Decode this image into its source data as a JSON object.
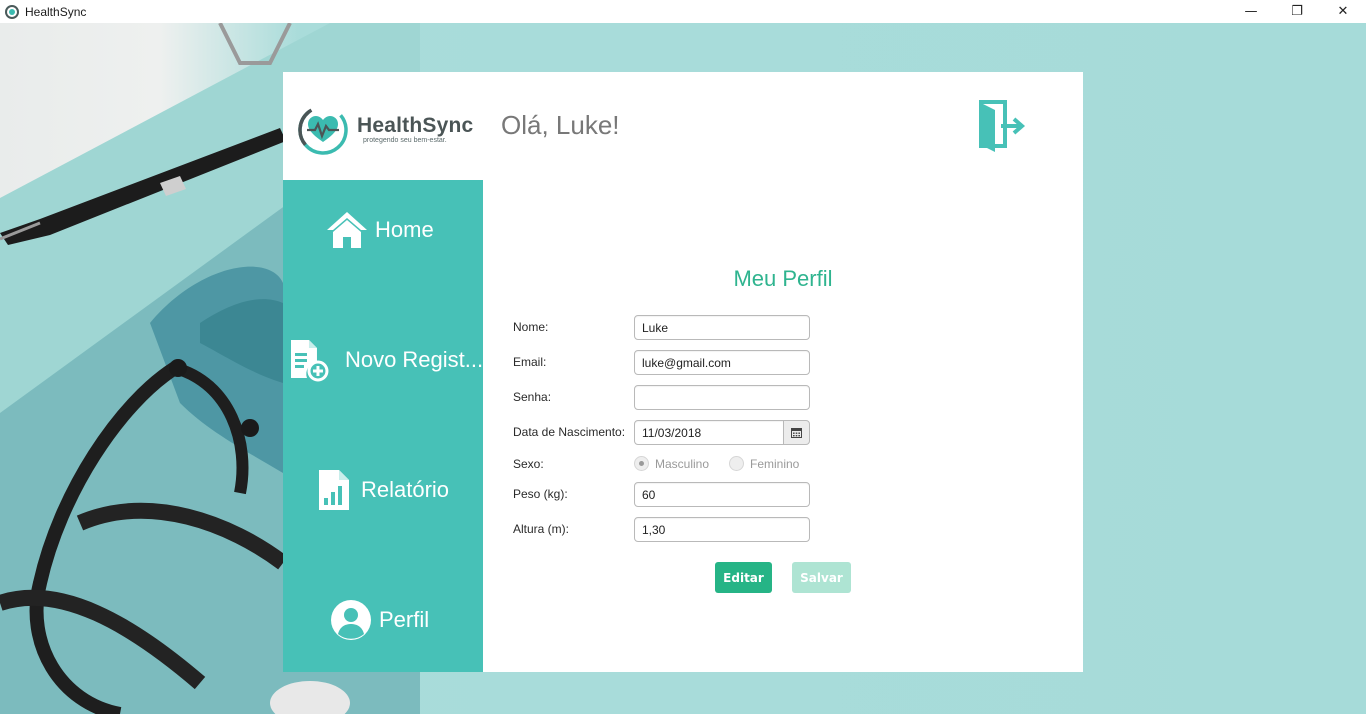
{
  "window": {
    "title": "HealthSync",
    "controls": {
      "minimize": "—",
      "maximize": "❐",
      "close": "✕"
    }
  },
  "brand": {
    "name": "HealthSync",
    "tagline": "protegendo seu bem-estar."
  },
  "header": {
    "greeting": "Olá, Luke!",
    "logout_icon": "logout-door-icon"
  },
  "sidebar": {
    "items": [
      {
        "label": "Home",
        "icon": "home-icon"
      },
      {
        "label": "Novo Regist...",
        "icon": "new-record-icon"
      },
      {
        "label": "Relatório",
        "icon": "report-icon"
      },
      {
        "label": "Perfil",
        "icon": "user-icon"
      }
    ]
  },
  "profile": {
    "title": "Meu Perfil",
    "fields": {
      "nome": {
        "label": "Nome:",
        "value": "Luke"
      },
      "email": {
        "label": "Email:",
        "value": "luke@gmail.com"
      },
      "senha": {
        "label": "Senha:",
        "value": ""
      },
      "nascimento": {
        "label": "Data de Nascimento:",
        "value": "11/03/2018"
      },
      "sexo": {
        "label": "Sexo:",
        "options": [
          "Masculino",
          "Feminino"
        ],
        "selected": "Masculino"
      },
      "peso": {
        "label": "Peso (kg):",
        "value": "60"
      },
      "altura": {
        "label": "Altura (m):",
        "value": "1,30"
      }
    },
    "buttons": {
      "edit": "Editar",
      "save": "Salvar"
    }
  },
  "colors": {
    "accent": "#47c1b7",
    "title": "#2fb48f",
    "edit_button": "#26b486",
    "save_button_disabled": "#aee4d3"
  }
}
